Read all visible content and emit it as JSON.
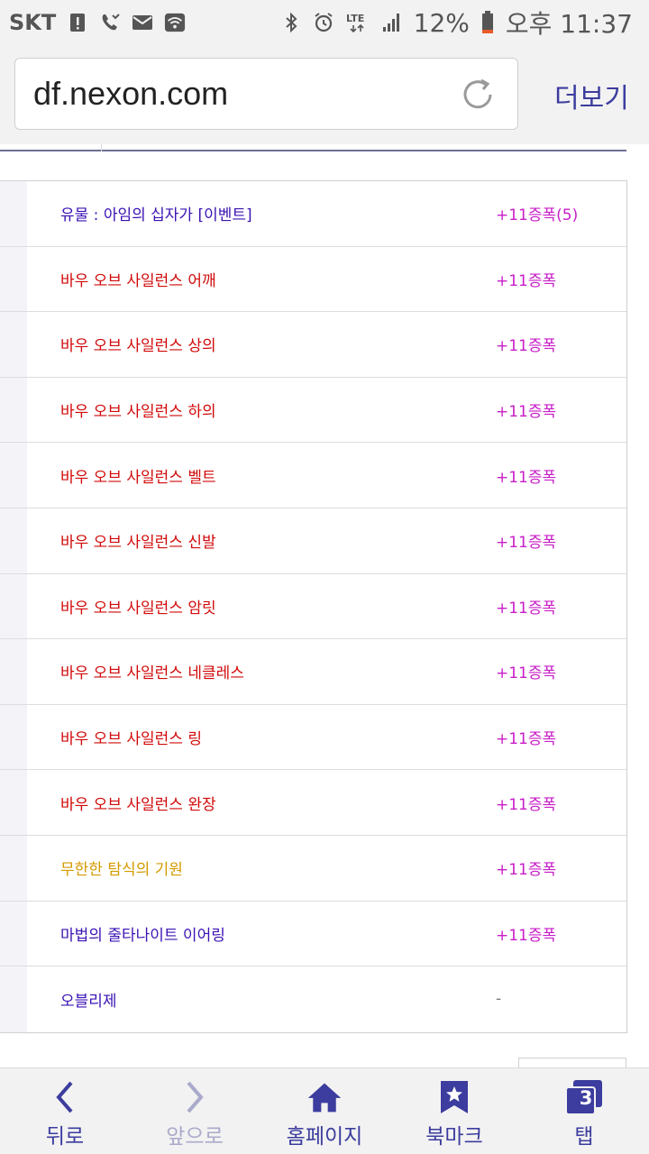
{
  "status_bar": {
    "carrier": "SKT",
    "battery": "12%",
    "time": "오후 11:37",
    "network": "LTE",
    "icons": [
      "alert-icon",
      "missed-call-icon",
      "mail-icon",
      "wifi-icon",
      "bluetooth-icon",
      "alarm-icon",
      "lte-icon",
      "signal-icon",
      "battery-icon"
    ]
  },
  "browser": {
    "url": "df.nexon.com",
    "more_label": "더보기"
  },
  "items": [
    {
      "name": "유물 : 아임의 십자가 [이벤트]",
      "value": "+11증폭(5)",
      "color": "#3a12b4"
    },
    {
      "name": "바우 오브 사일런스 어깨",
      "value": "+11증폭",
      "color": "#d20a0a"
    },
    {
      "name": "바우 오브 사일런스 상의",
      "value": "+11증폭",
      "color": "#d20a0a"
    },
    {
      "name": "바우 오브 사일런스 하의",
      "value": "+11증폭",
      "color": "#d20a0a"
    },
    {
      "name": "바우 오브 사일런스 벨트",
      "value": "+11증폭",
      "color": "#d20a0a"
    },
    {
      "name": "바우 오브 사일런스 신발",
      "value": "+11증폭",
      "color": "#d20a0a"
    },
    {
      "name": "바우 오브 사일런스 암릿",
      "value": "+11증폭",
      "color": "#d20a0a"
    },
    {
      "name": "바우 오브 사일런스 네클레스",
      "value": "+11증폭",
      "color": "#d20a0a"
    },
    {
      "name": "바우 오브 사일런스 링",
      "value": "+11증폭",
      "color": "#d20a0a"
    },
    {
      "name": "바우 오브 사일런스 완장",
      "value": "+11증폭",
      "color": "#d20a0a"
    },
    {
      "name": "무한한 탐식의 기원",
      "value": "+11증폭",
      "color": "#d49a00"
    },
    {
      "name": "마법의 줄타나이트 이어링",
      "value": "+11증폭",
      "color": "#3a12b4"
    },
    {
      "name": "오블리제",
      "value": "-",
      "color": "#3a12b4"
    }
  ],
  "bottom_nav": {
    "back": "뒤로",
    "forward": "앞으로",
    "home": "홈페이지",
    "bookmarks": "북마크",
    "tabs": "탭",
    "tab_count": "3"
  },
  "colors": {
    "accent": "#3c3d9e",
    "value": "#c81ec8",
    "legendary": "#d20a0a",
    "epic": "#d49a00",
    "unique": "#3a12b4"
  }
}
